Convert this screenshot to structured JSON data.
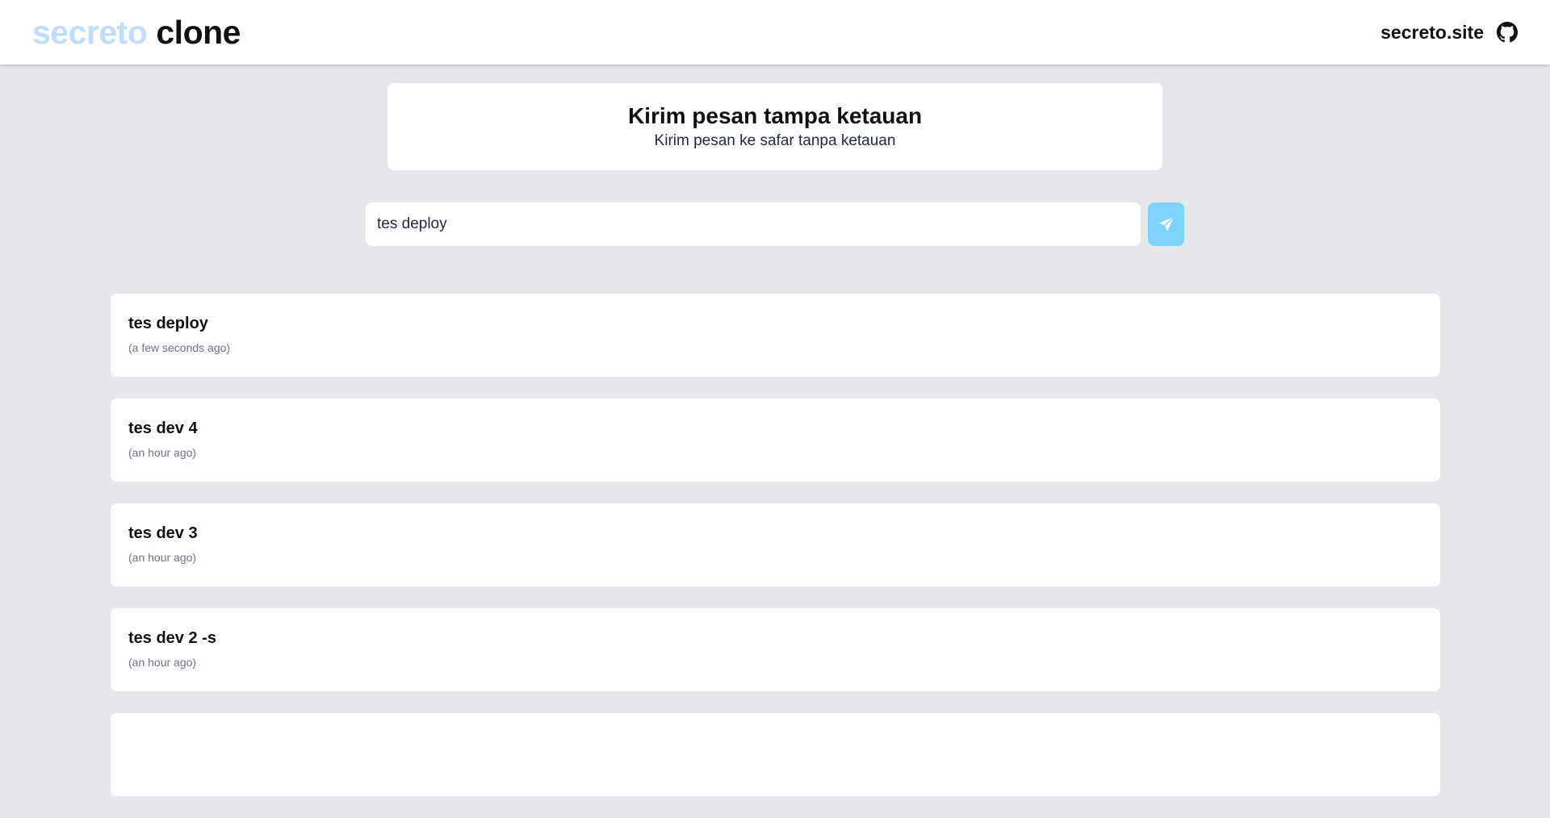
{
  "navbar": {
    "brand_accent": "secreto",
    "brand_main": "clone",
    "site_link": "secreto.site",
    "github_icon": "github-icon"
  },
  "header": {
    "title": "Kirim pesan tampa ketauan",
    "subtitle": "Kirim pesan ke safar tanpa ketauan"
  },
  "composer": {
    "value": "tes deploy",
    "send_icon": "send-icon"
  },
  "messages": [
    {
      "text": "tes deploy",
      "time": "(a few seconds ago)"
    },
    {
      "text": "tes dev 4",
      "time": "(an hour ago)"
    },
    {
      "text": "tes dev 3",
      "time": "(an hour ago)"
    },
    {
      "text": "tes dev 2 -s",
      "time": "(an hour ago)"
    },
    {
      "text": "",
      "time": ""
    }
  ],
  "colors": {
    "background": "#e5e7eb",
    "brand_accent": "#bfdbfe",
    "send_button": "#7dd3fc"
  }
}
